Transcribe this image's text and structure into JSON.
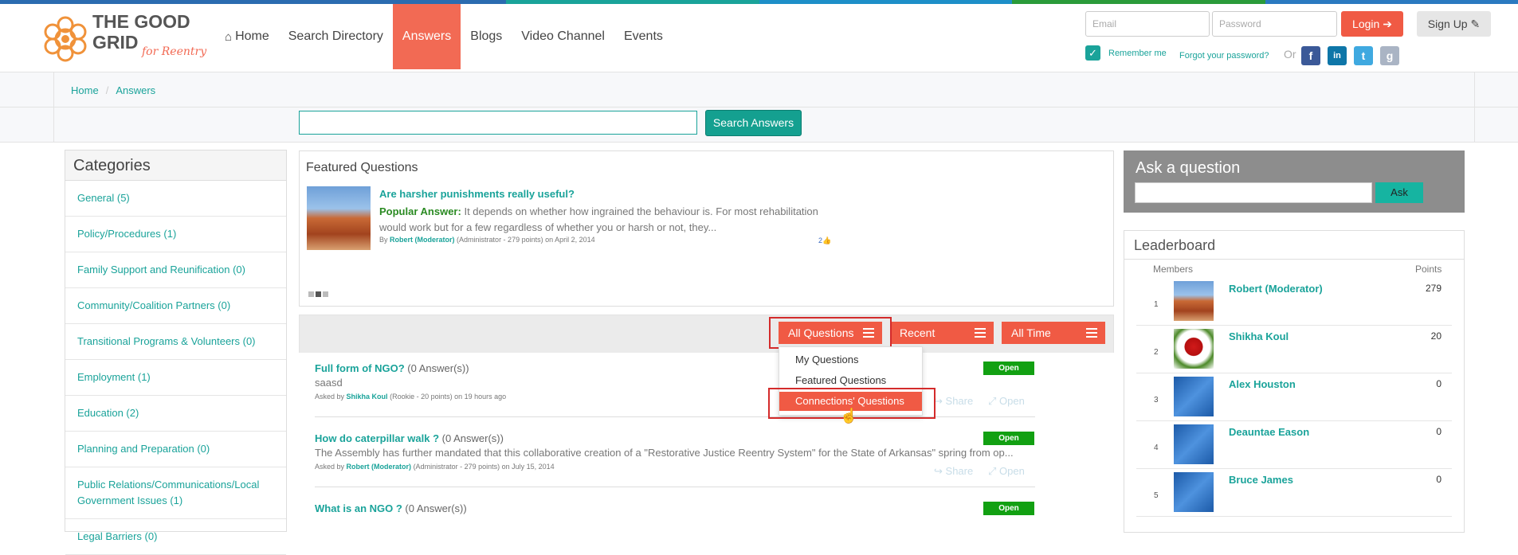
{
  "colors": {
    "accent": "#f05a44",
    "teal": "#1aa39a",
    "open_badge": "#12a012"
  },
  "brand": {
    "logo_text_1": "THE GOOD",
    "logo_text_2": "GRID",
    "logo_tagline": "for Reentry"
  },
  "nav": {
    "items": [
      {
        "label": "Home",
        "icon": "home-icon"
      },
      {
        "label": "Search Directory"
      },
      {
        "label": "Answers"
      },
      {
        "label": "Blogs"
      },
      {
        "label": "Video Channel"
      },
      {
        "label": "Events"
      }
    ]
  },
  "login": {
    "email_placeholder": "Email",
    "password_placeholder": "Password",
    "login_label": "Login",
    "signup_label": "Sign Up",
    "remember_label": "Remember me",
    "forgot_label": "Forgot your password?",
    "or_label": "Or"
  },
  "breadcrumb": {
    "home": "Home",
    "current": "Answers"
  },
  "search": {
    "button_label": "Search Answers"
  },
  "categories": {
    "title": "Categories",
    "items": [
      "General (5)",
      "Policy/Procedures (1)",
      "Family Support and Reunification (0)",
      "Community/Coalition Partners (0)",
      "Transitional Programs & Volunteers (0)",
      "Employment (1)",
      "Education (2)",
      "Planning and Preparation (0)",
      "Public Relations/Communications/Local Government Issues (1)",
      "Legal Barriers (0)"
    ]
  },
  "featured": {
    "title": "Featured Questions",
    "question": "Are harsher punishments really useful?",
    "answer_label": "Popular Answer:",
    "answer_text": "It depends on whether how ingrained the behaviour is. For most rehabilitation would work but for a few regardless of whether you or harsh or not, they...",
    "by_prefix": "By",
    "author": "Robert (Moderator)",
    "author_meta": "(Administrator - 279 points)  on April 2, 2014",
    "likes": "2"
  },
  "filters": {
    "all_questions": "All Questions",
    "recent": "Recent",
    "all_time": "All Time",
    "menu": [
      "My Questions",
      "Featured Questions",
      "Connections' Questions"
    ]
  },
  "questions": [
    {
      "title": "Full form of NGO?",
      "answers": "(0 Answer(s))",
      "body": "saasd",
      "asked_by": "Asked by",
      "author": "Shikha Koul",
      "meta": "(Rookie - 20 points)  on 19 hours ago",
      "status": "Open",
      "share": "Share",
      "open_action": "Open"
    },
    {
      "title": "How do caterpillar walk ?",
      "answers": "(0 Answer(s))",
      "body": "The Assembly has further mandated that this collaborative creation of a \"Restorative Justice Reentry System\" for the State of Arkansas\" spring from op...",
      "asked_by": "Asked by",
      "author": "Robert (Moderator)",
      "meta": "(Administrator - 279 points)  on July 15, 2014",
      "status": "Open",
      "share": "Share",
      "open_action": "Open"
    },
    {
      "title": "What is an NGO ?",
      "answers": "(0 Answer(s))",
      "status": "Open"
    }
  ],
  "ask": {
    "title": "Ask a question",
    "button_label": "Ask"
  },
  "leaderboard": {
    "title": "Leaderboard",
    "col_members": "Members",
    "col_points": "Points",
    "rows": [
      {
        "rank": "1",
        "name": "Robert (Moderator)",
        "points": "279"
      },
      {
        "rank": "2",
        "name": "Shikha Koul",
        "points": "20"
      },
      {
        "rank": "3",
        "name": "Alex Houston",
        "points": "0"
      },
      {
        "rank": "4",
        "name": "Deauntae Eason",
        "points": "0"
      },
      {
        "rank": "5",
        "name": "Bruce James",
        "points": "0"
      }
    ]
  }
}
